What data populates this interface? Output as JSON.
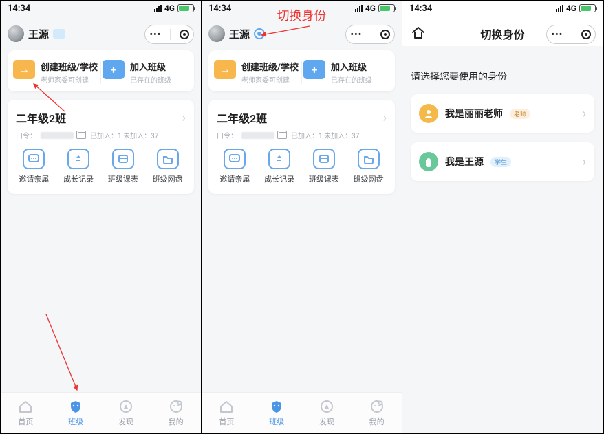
{
  "screen_a": {
    "statusbar_time": "14:34",
    "statusbar_net": "4G",
    "user_name": "王源",
    "create_class_title": "创建班级/学校",
    "create_class_sub": "老师家委可创建",
    "join_class_title": "加入班级",
    "join_class_sub": "已存在的班级",
    "class_name": "二年级2班",
    "class_code_label": "口令：",
    "class_joined_label": "已加入：1 未加入：37",
    "action_invite": "邀请亲属",
    "action_growth": "成长记录",
    "action_schedule": "班级课表",
    "action_disk": "班级网盘",
    "tab_home": "首页",
    "tab_class": "班级",
    "tab_discover": "发现",
    "tab_me": "我的"
  },
  "screen_b": {
    "annotation": "切换身份",
    "statusbar_time": "14:34",
    "statusbar_net": "4G",
    "user_name": "王源",
    "create_class_title": "创建班级/学校",
    "create_class_sub": "老师家委可创建",
    "join_class_title": "加入班级",
    "join_class_sub": "已存在的班级",
    "class_name": "二年级2班",
    "class_code_label": "口令：",
    "class_joined_label": "已加入：1 未加入：37",
    "action_invite": "邀请亲属",
    "action_growth": "成长记录",
    "action_schedule": "班级课表",
    "action_disk": "班级网盘",
    "tab_home": "首页",
    "tab_class": "班级",
    "tab_discover": "发现",
    "tab_me": "我的"
  },
  "screen_c": {
    "statusbar_time": "14:34",
    "statusbar_net": "4G",
    "page_title": "切换身份",
    "prompt": "请选择您要使用的身份",
    "option1_name": "我是丽丽老师",
    "option1_tag": "老师",
    "option2_name": "我是王源",
    "option2_tag": "学生"
  }
}
